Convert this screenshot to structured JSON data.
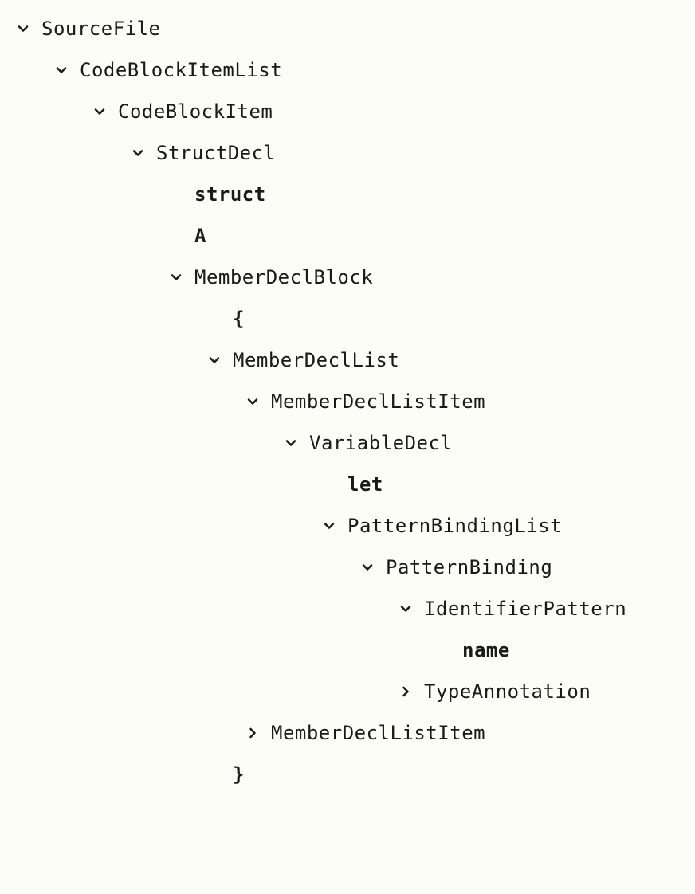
{
  "tree": {
    "sourceFile": "SourceFile",
    "codeBlockItemList": "CodeBlockItemList",
    "codeBlockItem": "CodeBlockItem",
    "structDecl": "StructDecl",
    "structKeyword": "struct",
    "structName": "A",
    "memberDeclBlock": "MemberDeclBlock",
    "openBrace": "{",
    "memberDeclList": "MemberDeclList",
    "memberDeclListItem1": "MemberDeclListItem",
    "variableDecl": "VariableDecl",
    "letKeyword": "let",
    "patternBindingList": "PatternBindingList",
    "patternBinding": "PatternBinding",
    "identifierPattern": "IdentifierPattern",
    "identifierName": "name",
    "typeAnnotation": "TypeAnnotation",
    "memberDeclListItem2": "MemberDeclListItem",
    "closeBrace": "}"
  }
}
